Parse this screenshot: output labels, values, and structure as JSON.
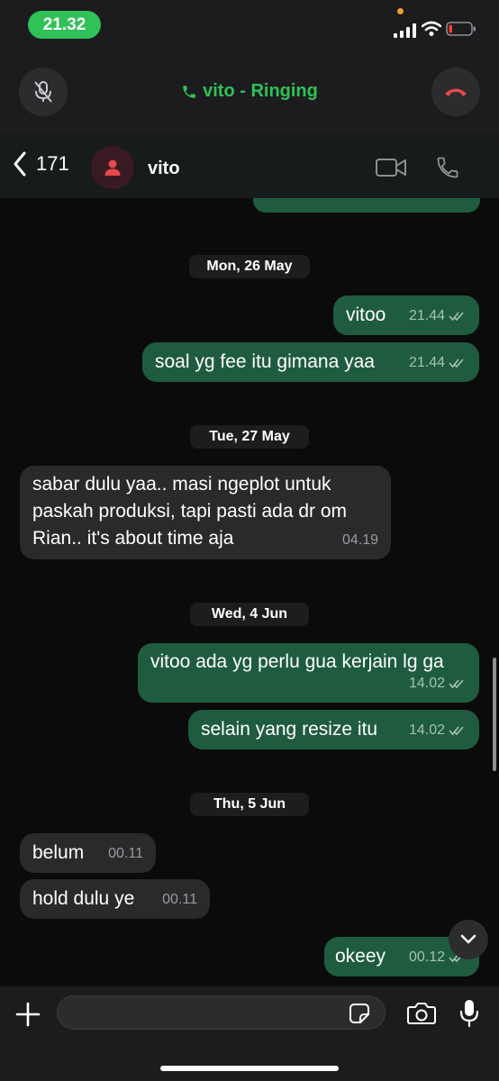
{
  "status": {
    "time": "21.32"
  },
  "call": {
    "status_text": "vito - Ringing"
  },
  "header": {
    "back_count": "171",
    "contact_name": "vito"
  },
  "dates": [
    "Mon, 26 May",
    "Tue, 27 May",
    "Wed, 4 Jun",
    "Thu, 5 Jun"
  ],
  "messages": [
    {
      "text": "vitoo",
      "time": "21.44",
      "dir": "out"
    },
    {
      "text": "soal yg fee itu gimana yaa",
      "time": "21.44",
      "dir": "out"
    },
    {
      "text_lines": [
        "sabar dulu yaa.. masi ngeplot untuk",
        "paskah produksi, tapi pasti ada dr om",
        "Rian.. it's about time aja"
      ],
      "time": "04.19",
      "dir": "in"
    },
    {
      "text": "vitoo ada yg perlu gua kerjain lg ga",
      "time": "14.02",
      "dir": "out"
    },
    {
      "text": "selain yang resize itu",
      "time": "14.02",
      "dir": "out"
    },
    {
      "text": "belum",
      "time": "00.11",
      "dir": "in"
    },
    {
      "text": "hold dulu ye",
      "time": "00.11",
      "dir": "in"
    },
    {
      "text": "okeey",
      "time": "00.12",
      "dir": "out"
    }
  ],
  "colors": {
    "accent_green": "#30c158",
    "outgoing_bubble": "#1f5c3f",
    "incoming_bubble": "#2a2a2c",
    "end_call_red": "#e5484d"
  }
}
